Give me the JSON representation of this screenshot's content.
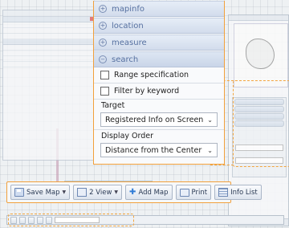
{
  "accordion": [
    {
      "label": "mapinfo",
      "icon": "plus-circle-icon"
    },
    {
      "label": "location",
      "icon": "plus-circle-icon"
    },
    {
      "label": "measure",
      "icon": "plus-circle-icon"
    },
    {
      "label": "search",
      "icon": "minus-circle-icon"
    }
  ],
  "search": {
    "range_spec_label": "Range specification",
    "filter_keyword_label": "Filter by keyword",
    "target_label": "Target",
    "target_value": "Registered Info on Screen",
    "order_label": "Display Order",
    "order_value": "Distance from the Center"
  },
  "toolbar": {
    "save_map": "Save Map",
    "view": "2 View",
    "add_map": "Add Map",
    "print": "Print",
    "info_list": "Info List"
  },
  "colors": {
    "highlight": "#f2a03b",
    "accordion_text": "#5670a0"
  }
}
